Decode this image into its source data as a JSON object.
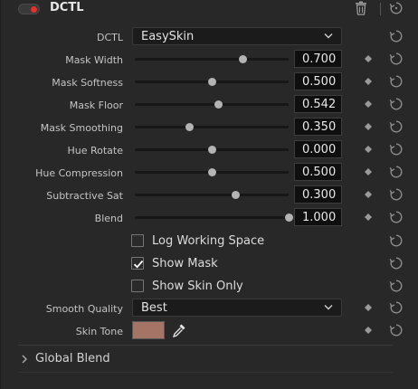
{
  "header": {
    "title": "DCTL",
    "enabled": true
  },
  "dctl": {
    "label": "DCTL",
    "selected": "EasySkin"
  },
  "sliders": [
    {
      "label": "Mask Width",
      "value": "0.700",
      "fraction": 0.7
    },
    {
      "label": "Mask Softness",
      "value": "0.500",
      "fraction": 0.5
    },
    {
      "label": "Mask Floor",
      "value": "0.542",
      "fraction": 0.542
    },
    {
      "label": "Mask Smoothing",
      "value": "0.350",
      "fraction": 0.35
    },
    {
      "label": "Hue Rotate",
      "value": "0.000",
      "fraction": 0.5
    },
    {
      "label": "Hue Compression",
      "value": "0.500",
      "fraction": 0.5
    },
    {
      "label": "Subtractive Sat",
      "value": "0.300",
      "fraction": 0.65
    },
    {
      "label": "Blend",
      "value": "1.000",
      "fraction": 1.0
    }
  ],
  "checkboxes": [
    {
      "label": "Log Working Space",
      "checked": false
    },
    {
      "label": "Show Mask",
      "checked": true
    },
    {
      "label": "Show Skin Only",
      "checked": false
    }
  ],
  "smooth_quality": {
    "label": "Smooth Quality",
    "selected": "Best"
  },
  "skin_tone": {
    "label": "Skin Tone",
    "color": "#a57466"
  },
  "global_blend": {
    "label": "Global Blend",
    "expanded": false
  },
  "colors": {
    "accent_toggle": "#e0322f",
    "panel_bg": "#282828"
  },
  "icons": {
    "trash": "trash-icon",
    "reset": "reset-icon",
    "keyframe": "keyframe-icon",
    "picker": "eyedropper-icon"
  }
}
